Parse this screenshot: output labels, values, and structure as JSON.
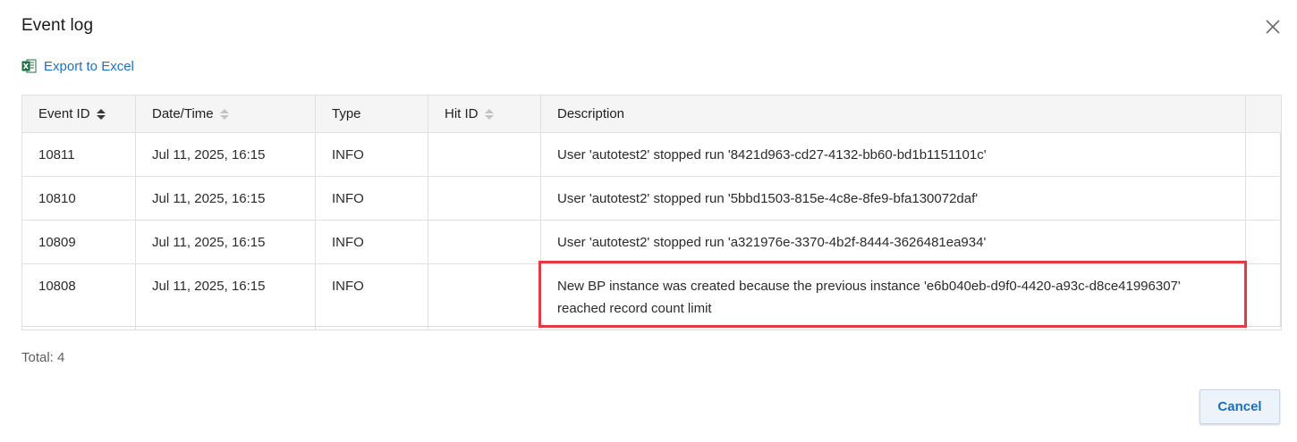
{
  "dialog": {
    "title": "Event log",
    "close_icon": "close-icon"
  },
  "toolbar": {
    "export_label": "Export to Excel",
    "export_icon": "excel-icon",
    "export_icon_color": "#1d7044"
  },
  "table": {
    "columns": [
      {
        "label": "Event ID",
        "sortable": true,
        "sort": "ascending"
      },
      {
        "label": "Date/Time",
        "sortable": true,
        "sort": "none"
      },
      {
        "label": "Type",
        "sortable": false
      },
      {
        "label": "Hit ID",
        "sortable": true,
        "sort": "none"
      },
      {
        "label": "Description",
        "sortable": false
      }
    ],
    "rows": [
      {
        "event_id": "10811",
        "datetime": "Jul 11, 2025, 16:15",
        "type": "INFO",
        "hit_id": "",
        "description": "User 'autotest2' stopped run '8421d963-cd27-4132-bb60-bd1b1151101c'"
      },
      {
        "event_id": "10810",
        "datetime": "Jul 11, 2025, 16:15",
        "type": "INFO",
        "hit_id": "",
        "description": "User 'autotest2' stopped run '5bbd1503-815e-4c8e-8fe9-bfa130072daf'"
      },
      {
        "event_id": "10809",
        "datetime": "Jul 11, 2025, 16:15",
        "type": "INFO",
        "hit_id": "",
        "description": "User 'autotest2' stopped run 'a321976e-3370-4b2f-8444-3626481ea934'"
      },
      {
        "event_id": "10808",
        "datetime": "Jul 11, 2025, 16:15",
        "type": "INFO",
        "hit_id": "",
        "description_line1": "New BP instance was created because the previous instance 'e6b040eb-d9f0-4420-a93c-d8ce41996307'",
        "description_line2": "reached record count limit"
      }
    ]
  },
  "footer": {
    "total": "Total: 4",
    "cancel_label": "Cancel"
  },
  "colors": {
    "link": "#1a73c8",
    "highlight_border": "#e23b43",
    "header_bg": "#f5f5f5",
    "cancel_text": "#1a6fc0",
    "cancel_bg": "#edf3fb"
  }
}
